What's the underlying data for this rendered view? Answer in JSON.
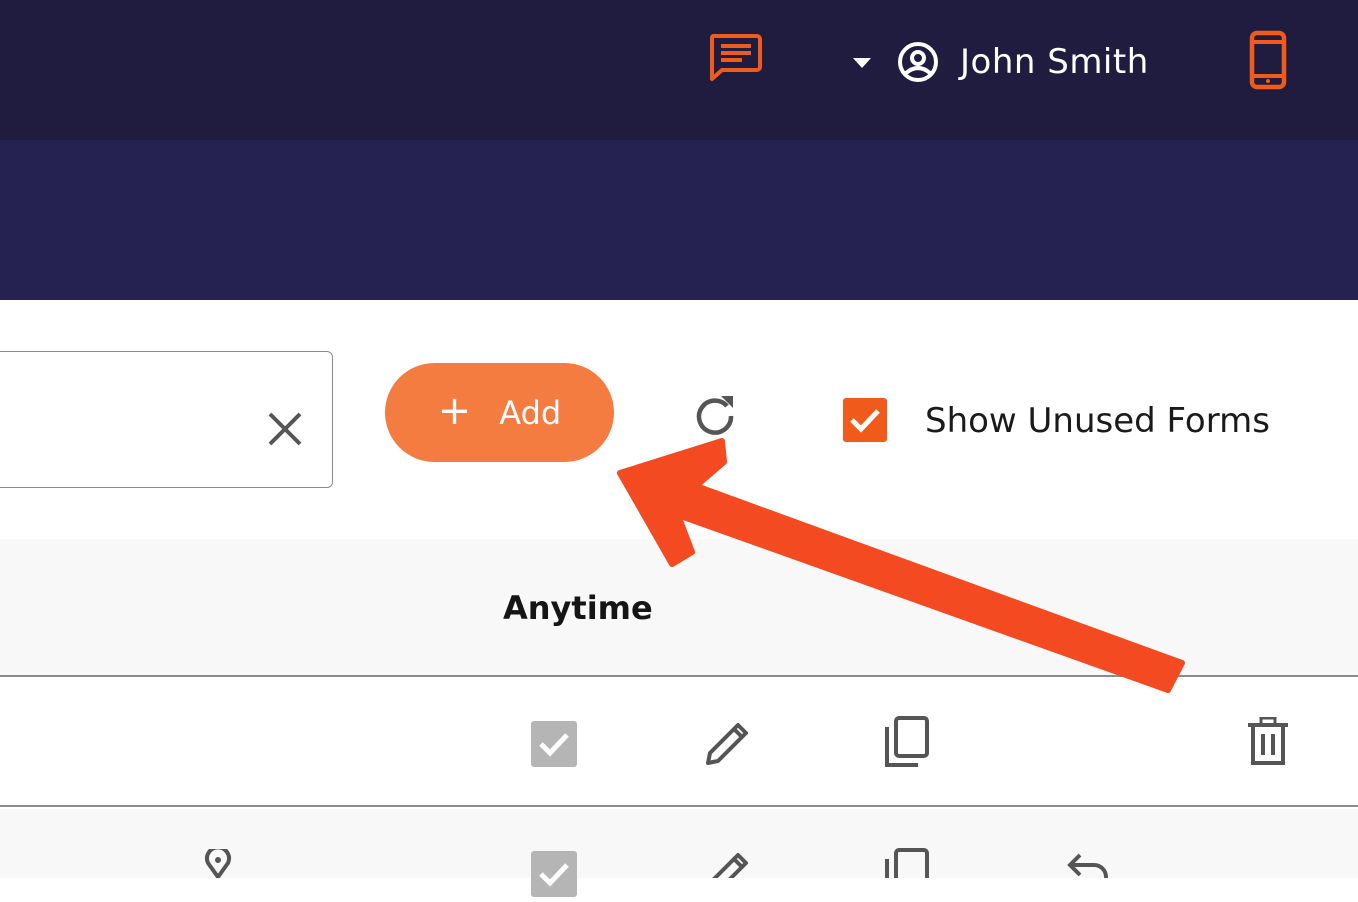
{
  "header": {
    "user_name": "John Smith",
    "icons": [
      "chat-icon",
      "dropdown-caret-icon",
      "user-account-icon",
      "mobile-icon"
    ]
  },
  "toolbar": {
    "add_label": "Add",
    "add_icon": "plus-icon",
    "clear_icon": "close-icon",
    "refresh_icon": "refresh-icon",
    "show_unused_label": "Show Unused Forms",
    "show_unused_checked": true
  },
  "table": {
    "columns": [
      "Anytime"
    ],
    "row_actions": [
      "checked-box-icon",
      "edit-pencil-icon",
      "copy-icon",
      "trash-icon",
      "location-pin-icon",
      "undo-icon"
    ]
  },
  "colors": {
    "topbar": "#1f1c40",
    "subbar": "#252150",
    "accent": "#f47c40",
    "checkbox": "#f05a1a",
    "annotation_arrow": "#f44a22"
  }
}
